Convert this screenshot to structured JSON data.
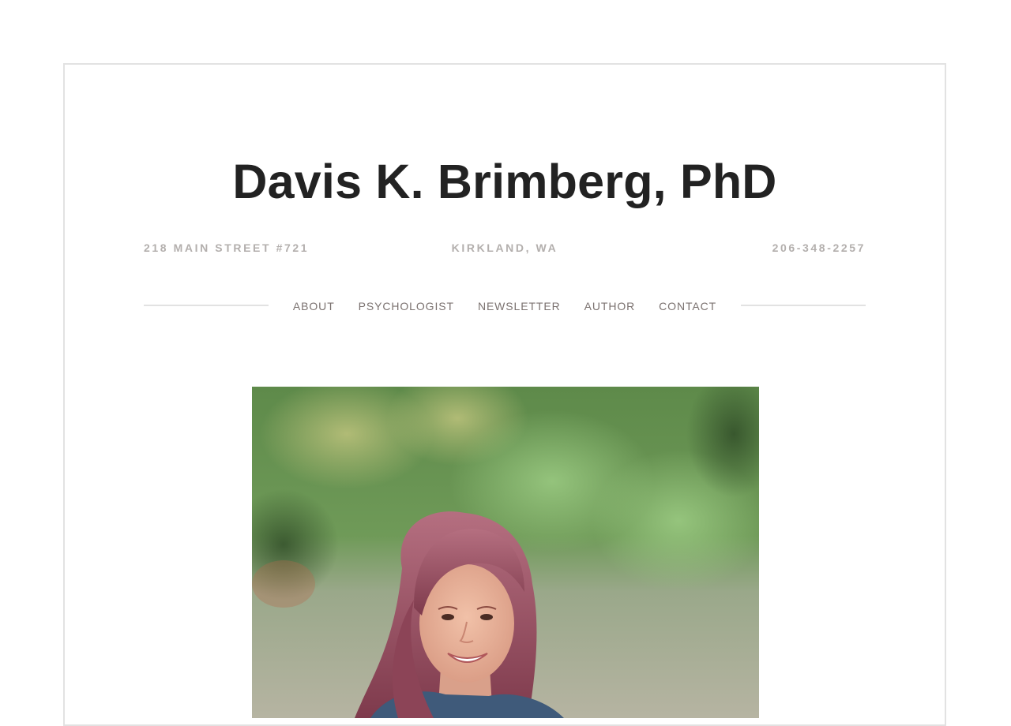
{
  "site": {
    "title": "Davis K. Brimberg, PhD"
  },
  "contact_info": {
    "address": "218 MAIN STREET #721",
    "city": "KIRKLAND, WA",
    "phone": "206-348-2257"
  },
  "nav": {
    "items": [
      {
        "label": "ABOUT"
      },
      {
        "label": "PSYCHOLOGIST"
      },
      {
        "label": "NEWSLETTER"
      },
      {
        "label": "AUTHOR"
      },
      {
        "label": "CONTACT"
      }
    ]
  },
  "colors": {
    "title": "#222222",
    "info_text": "#b3afad",
    "nav_text": "#7b7270",
    "frame_border": "#e2e2e2"
  }
}
